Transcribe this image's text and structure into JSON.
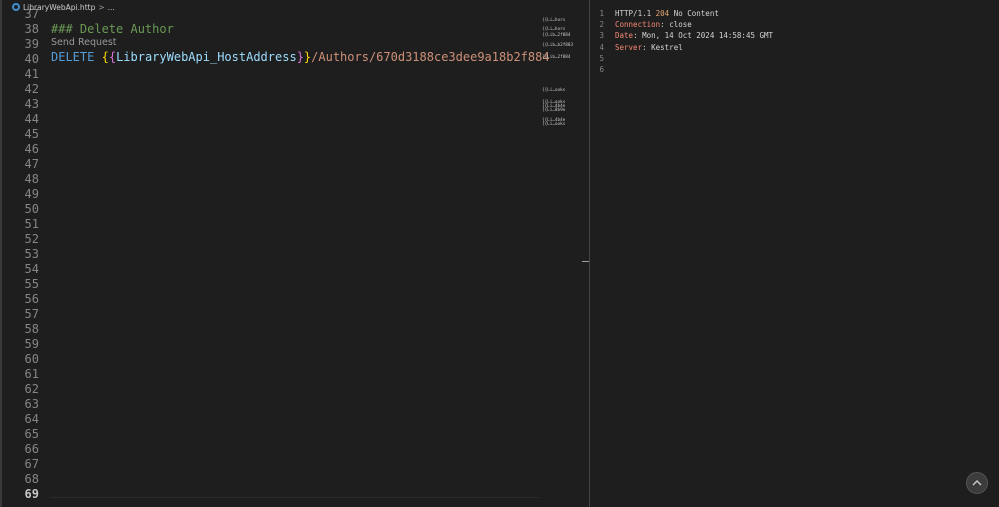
{
  "breadcrumb": {
    "file_name": "LibraryWebApi.http",
    "separator": ">",
    "more": "..."
  },
  "editor": {
    "line_numbers": [
      "37",
      "38",
      "39",
      "40",
      "41",
      "42",
      "43",
      "44",
      "45",
      "46",
      "47",
      "48",
      "49",
      "50",
      "51",
      "52",
      "53",
      "54",
      "55",
      "56",
      "57",
      "58",
      "59",
      "60",
      "61",
      "62",
      "63",
      "64",
      "65",
      "66",
      "67",
      "68",
      "69"
    ],
    "current_line": "69",
    "comment_line": "### Delete Author",
    "codelens": "Send Request",
    "request": {
      "method": "DELETE",
      "brace_open_outer": "{",
      "brace_open_inner": "{",
      "variable": "LibraryWebApi_HostAddress",
      "brace_close_inner": "}",
      "brace_close_outer": "}",
      "path": "/Authors/670d3188ce3dee9a18b2f884"
    }
  },
  "minimap": {
    "lines": [
      "{{Li…hors",
      "{{Li…hors",
      "{{Lib…2f884",
      "{{Lib…b2f883",
      "{{Lib…2f884",
      "{{Li…ooks",
      "{{Li…ooks",
      "{{Li…4b4e",
      "{{Li…8b9e",
      "{{Li…4b4e",
      "{{Li…ooks"
    ]
  },
  "response": {
    "line_numbers": [
      "1",
      "2",
      "3",
      "4",
      "5",
      "6"
    ],
    "status_line": {
      "protocol": "HTTP/1.1 ",
      "code": "204",
      "text": " No Content"
    },
    "headers": [
      {
        "key": "Connection",
        "value": "close"
      },
      {
        "key": "Date",
        "value": "Mon, 14 Oct 2024 14:58:45 GMT"
      },
      {
        "key": "Server",
        "value": "Kestrel"
      }
    ],
    "header_separator": ": "
  },
  "icons": {
    "scroll_top": "chevron-up-icon",
    "file": "http-file-icon"
  }
}
